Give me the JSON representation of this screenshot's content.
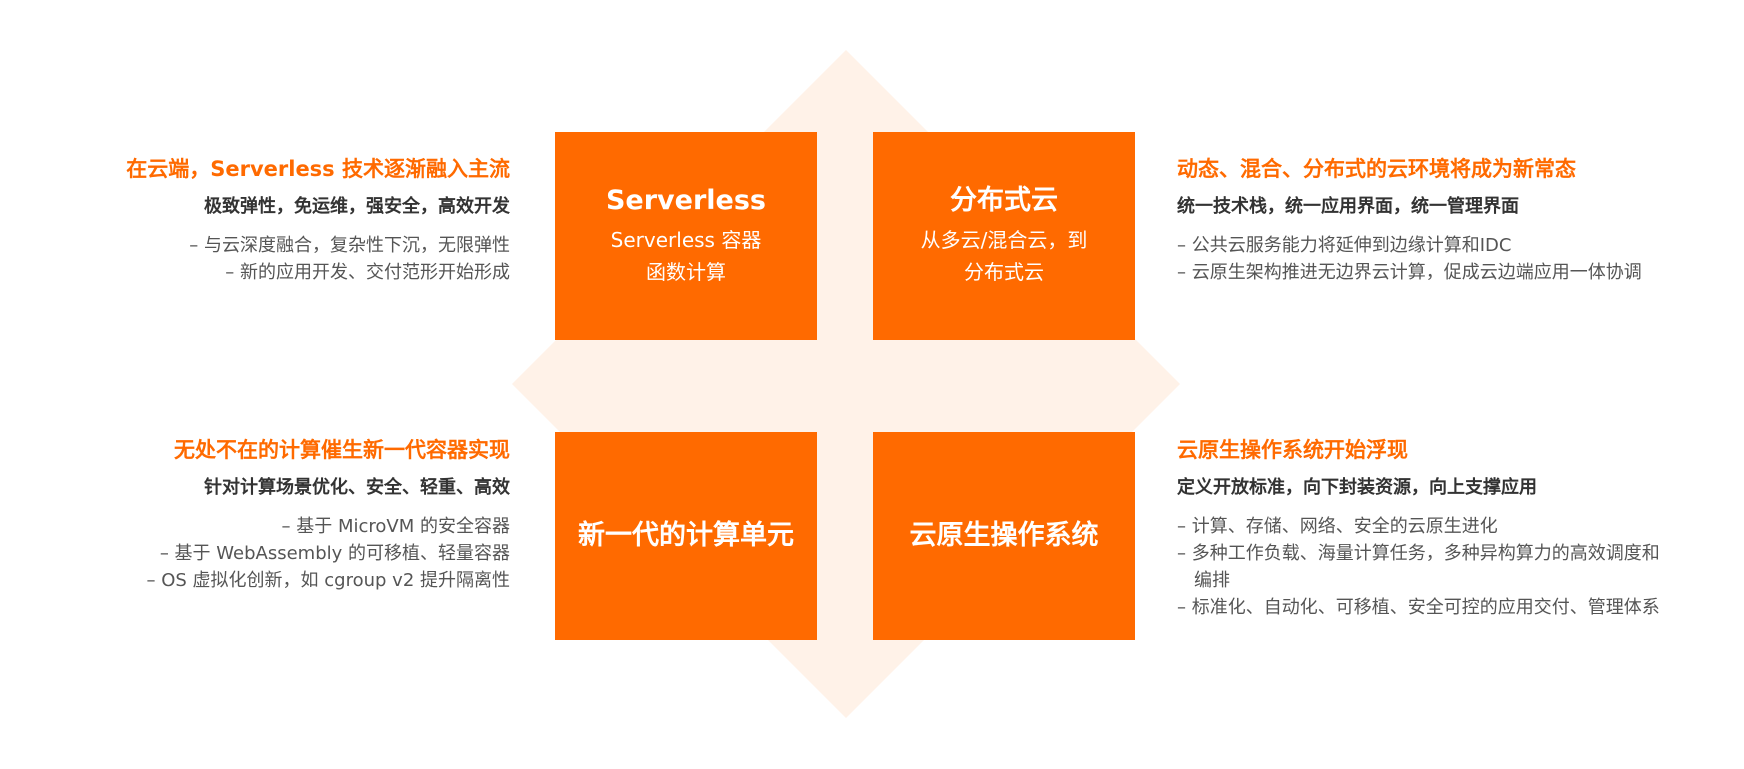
{
  "colors": {
    "accent": "#ff6a00",
    "diamond": "#fff2e8",
    "heading_text": "#333333",
    "body_text": "#555555"
  },
  "boxes": {
    "top_left": {
      "title": "Serverless",
      "lines": [
        "Serverless 容器",
        "函数计算"
      ]
    },
    "top_right": {
      "title": "分布式云",
      "lines": [
        "从多云/混合云，到",
        "分布式云"
      ]
    },
    "bottom_left": {
      "title": "新一代的计算单元"
    },
    "bottom_right": {
      "title": "云原生操作系统"
    }
  },
  "blocks": {
    "top_left": {
      "heading": "在云端，Serverless 技术逐渐融入主流",
      "subheading": "极致弹性，免运维，强安全，高效开发",
      "items": [
        "– 与云深度融合，复杂性下沉，无限弹性",
        "– 新的应用开发、交付范形开始形成"
      ]
    },
    "top_right": {
      "heading": "动态、混合、分布式的云环境将成为新常态",
      "subheading": "统一技术栈，统一应用界面，统一管理界面",
      "items": [
        "– 公共云服务能力将延伸到边缘计算和IDC",
        "– 云原生架构推进无边界云计算，促成云边端应用一体协调"
      ]
    },
    "bottom_left": {
      "heading": "无处不在的计算催生新一代容器实现",
      "subheading": "针对计算场景优化、安全、轻重、高效",
      "items": [
        "– 基于 MicroVM 的安全容器",
        "– 基于 WebAssembly 的可移植、轻量容器",
        "– OS 虚拟化创新，如 cgroup v2 提升隔离性"
      ]
    },
    "bottom_right": {
      "heading": "云原生操作系统开始浮现",
      "subheading": "定义开放标准，向下封装资源，向上支撑应用",
      "items": [
        "– 计算、存储、网络、安全的云原生进化",
        "– 多种工作负载、海量计算任务，多种异构算力的高效调度和编排",
        "– 标准化、自动化、可移植、安全可控的应用交付、管理体系"
      ]
    }
  }
}
